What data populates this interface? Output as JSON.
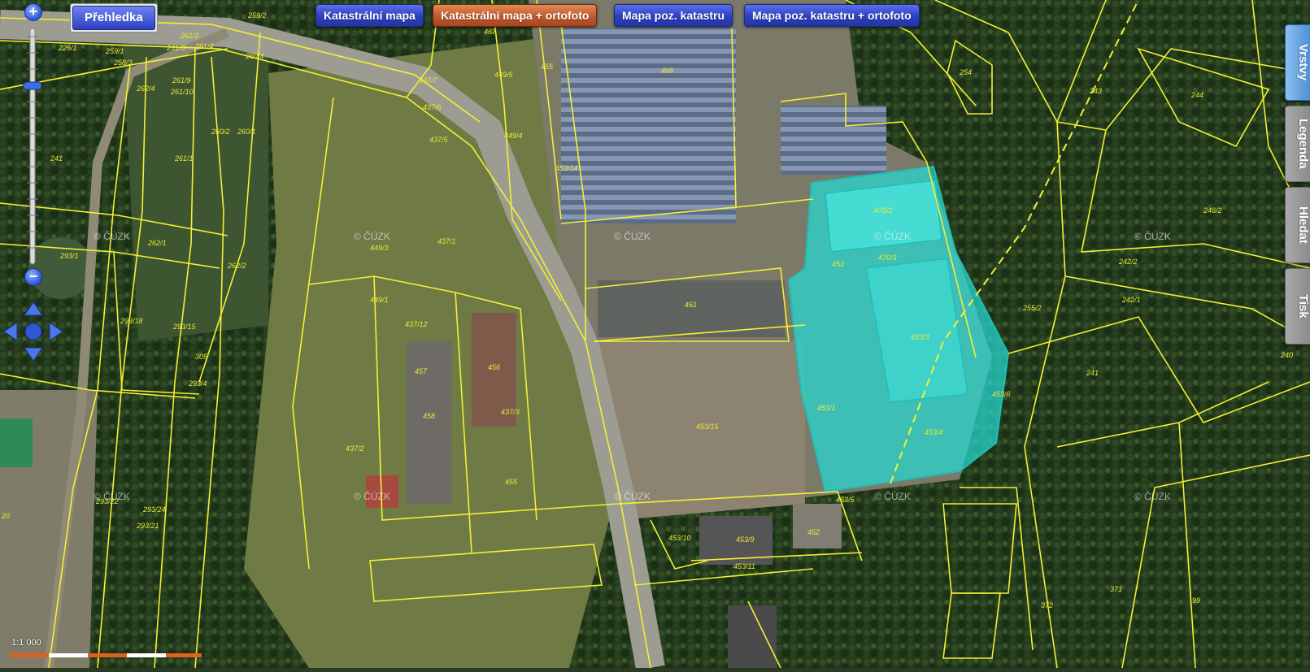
{
  "toolbar": {
    "overview": "Přehledka",
    "buttons": [
      {
        "label": "Katastrální mapa",
        "active": false
      },
      {
        "label": "Katastrální mapa + ortofoto",
        "active": true
      },
      {
        "label": "Mapa poz. katastru",
        "active": false
      },
      {
        "label": "Mapa poz. katastru + ortofoto",
        "active": false
      }
    ]
  },
  "side_tabs": [
    {
      "label": "Vrstvy",
      "active": true
    },
    {
      "label": "Legenda",
      "active": false
    },
    {
      "label": "Hledat",
      "active": false
    },
    {
      "label": "Tisk",
      "active": false
    }
  ],
  "zoom": {
    "in_icon": "plus-icon",
    "out_icon": "minus-icon",
    "pan_icon": "pan-arrows-icon"
  },
  "scale": "1:1 000",
  "watermark": "© ČÚZK",
  "colors": {
    "parcel_line": "#f3f033",
    "highlight": "#26d9d3",
    "button_blue": "#2c3fc0",
    "button_active": "#c2582a"
  },
  "parcels": [
    "259/2",
    "261/2",
    "226/1",
    "259/1",
    "258/3",
    "261/3",
    "261/4",
    "260/4",
    "262/4",
    "261/9",
    "261/10",
    "261/1",
    "260/1",
    "260/2",
    "241",
    "262/1",
    "262/2",
    "293/1",
    "293/18",
    "293/15",
    "305",
    "293/4",
    "293/22",
    "293/24",
    "293/21",
    "437/7",
    "437/6",
    "437/5",
    "437/1",
    "437/12",
    "437/2",
    "437/3",
    "449/3",
    "449/1",
    "449/4",
    "449/5",
    "453/14",
    "455",
    "467",
    "468",
    "470/2",
    "470/3",
    "453",
    "461",
    "453/3",
    "453/1",
    "453/4",
    "453/6",
    "453/5",
    "453/10",
    "453/9",
    "453/11",
    "452",
    "457",
    "458",
    "456",
    "455",
    "254",
    "243",
    "244",
    "242/2",
    "242/1",
    "241",
    "246/2",
    "240",
    "255/2",
    "371",
    "372",
    "99",
    "453/15",
    "20"
  ]
}
